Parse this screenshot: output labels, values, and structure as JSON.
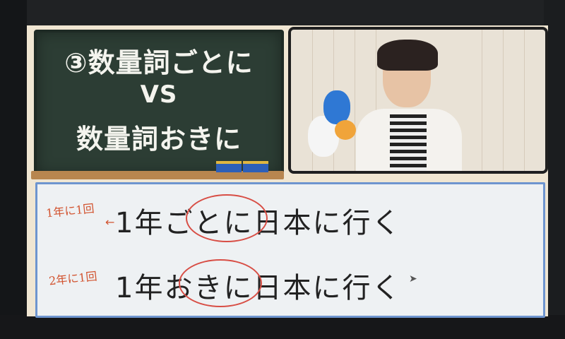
{
  "chalkboard": {
    "line1": "③数量詞ごとに",
    "line2": "VS",
    "line3": "数量詞おきに"
  },
  "notes": {
    "note1": "1年に1回",
    "note2": "2年に1回",
    "arrow": "←"
  },
  "sentences": {
    "s1": "1年ごとに日本に行く",
    "s2": "1年おきに日本に行く"
  },
  "colors": {
    "board": "#2c3d34",
    "panel_border": "#6e95cf",
    "annotation": "#d25430"
  }
}
